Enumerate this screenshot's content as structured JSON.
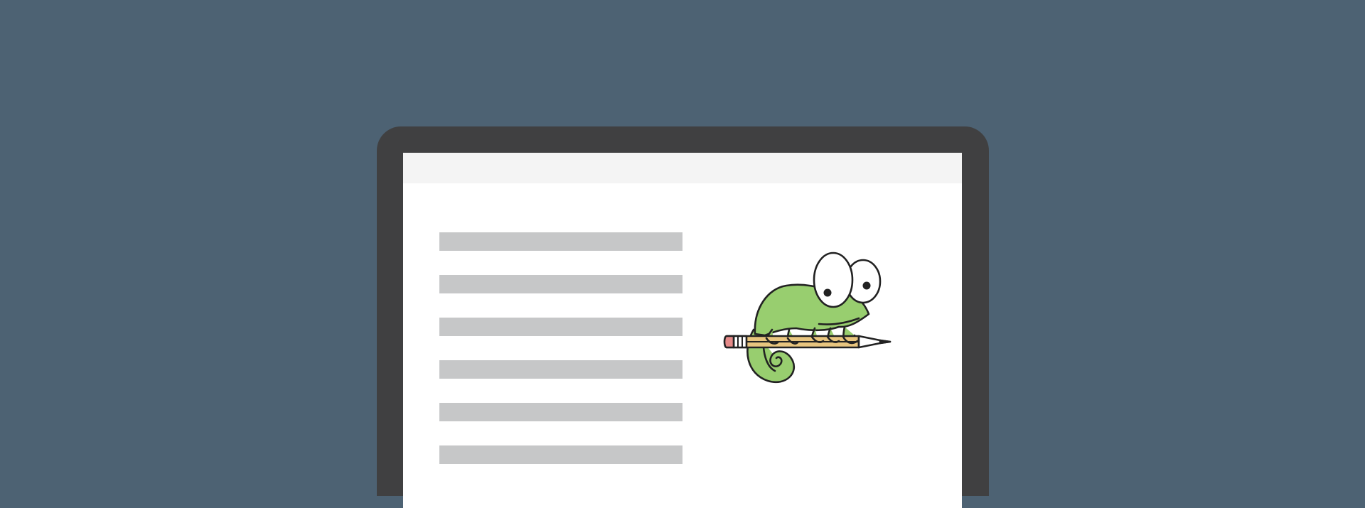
{
  "screen": {
    "document_line_count": 6
  },
  "mascot": {
    "icon": "chameleon-with-pencil-icon",
    "colors": {
      "body": "#98ce6f",
      "outline": "#222222",
      "pencil": "#e8c57f",
      "eraser": "#e58a89"
    }
  },
  "colors": {
    "background": "#4d6273",
    "bezel": "#404041",
    "title_bar": "#f4f4f4",
    "screen": "#ffffff",
    "doc_line": "#c6c7c8"
  }
}
